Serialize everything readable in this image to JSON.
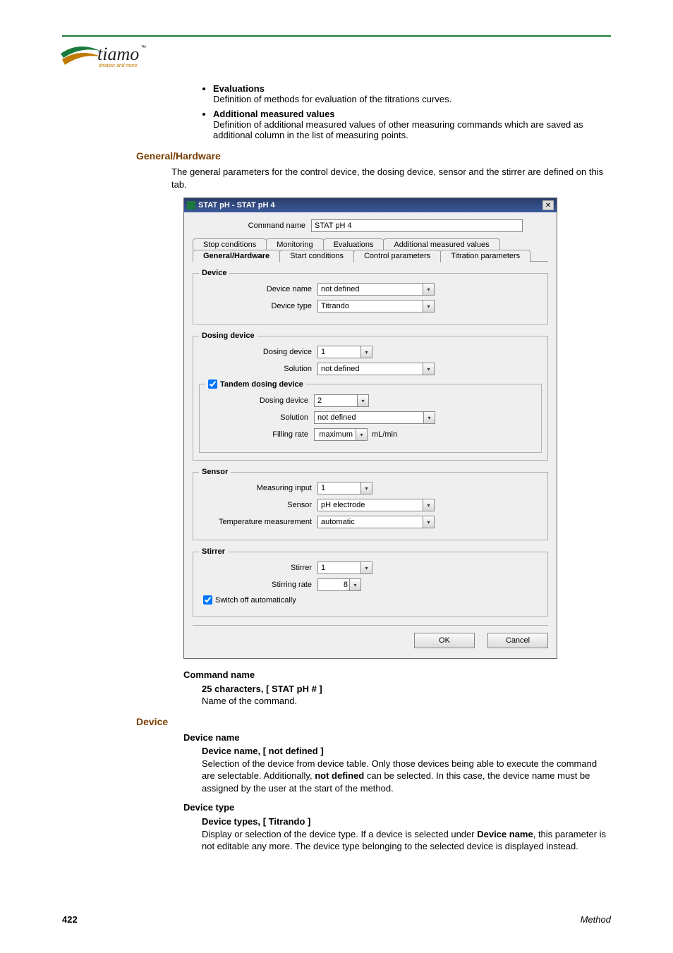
{
  "logo": {
    "brand": "tiamo",
    "tm": "™",
    "tagline": "titration and more"
  },
  "bullets": {
    "items": [
      {
        "title": "Evaluations",
        "desc": "Definition of methods for evaluation of the titrations curves."
      },
      {
        "title": "Additional measured values",
        "desc": "Definition of additional measured values of other measuring commands which are saved as additional column in the list of measuring points."
      }
    ]
  },
  "section1": {
    "heading": "General/Hardware",
    "intro": "The general parameters for the control device, the dosing device, sensor and the stirrer are defined on this tab."
  },
  "dialog": {
    "title": "STAT pH - STAT pH 4",
    "close": "✕",
    "command_name": {
      "label": "Command name",
      "value": "STAT pH 4"
    },
    "tabs_row1": [
      "Stop conditions",
      "Monitoring",
      "Evaluations",
      "Additional measured values"
    ],
    "tabs_row2": [
      "General/Hardware",
      "Start conditions",
      "Control parameters",
      "Titration parameters"
    ],
    "device": {
      "legend": "Device",
      "name": {
        "label": "Device name",
        "value": "not defined"
      },
      "type": {
        "label": "Device type",
        "value": "Titrando"
      }
    },
    "dosing": {
      "legend": "Dosing device",
      "device": {
        "label": "Dosing device",
        "value": "1"
      },
      "solution": {
        "label": "Solution",
        "value": "not defined"
      },
      "tandem": {
        "label": "Tandem dosing device",
        "checked": true
      },
      "device2": {
        "label": "Dosing device",
        "value": "2"
      },
      "solution2": {
        "label": "Solution",
        "value": "not defined"
      },
      "fillrate": {
        "label": "Filling rate",
        "value": "maximum",
        "unit": "mL/min"
      }
    },
    "sensor": {
      "legend": "Sensor",
      "meas_input": {
        "label": "Measuring input",
        "value": "1"
      },
      "sensor": {
        "label": "Sensor",
        "value": "pH electrode"
      },
      "temp": {
        "label": "Temperature measurement",
        "value": "automatic"
      }
    },
    "stirrer": {
      "legend": "Stirrer",
      "stirrer": {
        "label": "Stirrer",
        "value": "1"
      },
      "rate": {
        "label": "Stirring rate",
        "value": "8"
      },
      "auto_off": {
        "label": "Switch off automatically",
        "checked": true
      }
    },
    "buttons": {
      "ok": "OK",
      "cancel": "Cancel"
    }
  },
  "defs": {
    "command_name": {
      "term": "Command name",
      "spec": "25 characters, [ STAT pH # ]",
      "desc": "Name of the command."
    },
    "device_heading": "Device",
    "device_name": {
      "term": "Device name",
      "spec": "Device name, [ not defined ]",
      "desc_pre": "Selection of the device from device table. Only those devices being able to execute the command are selectable. Additionally, ",
      "desc_bold": "not defined",
      "desc_post": " can be selected. In this case, the device name must be assigned by the user at the start of the method."
    },
    "device_type": {
      "term": "Device type",
      "spec": "Device types, [ Titrando ]",
      "desc_pre": "Display or selection of the device type. If a device is selected under ",
      "desc_bold": "Device name",
      "desc_post": ", this parameter is not editable any more. The device type belonging to the selected device is displayed instead."
    }
  },
  "footer": {
    "page": "422",
    "section": "Method"
  }
}
